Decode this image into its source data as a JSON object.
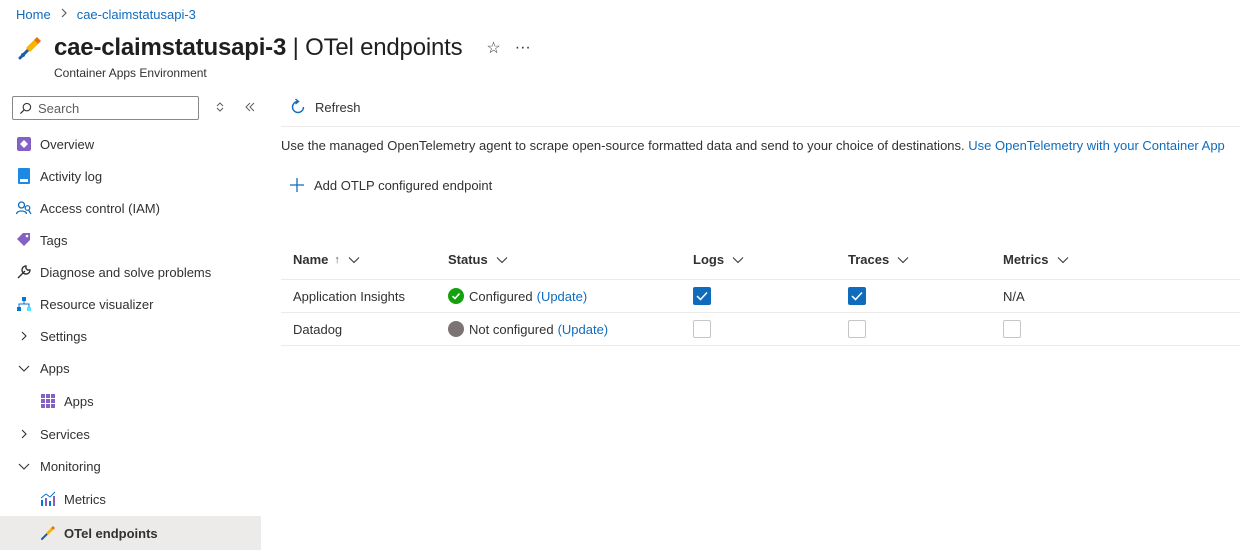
{
  "breadcrumb": {
    "home": "Home",
    "resource": "cae-claimstatusapi-3"
  },
  "header": {
    "title_resource": "cae-claimstatusapi-3",
    "title_page": "| OTel endpoints",
    "subtitle": "Container Apps Environment",
    "favorite_glyph": "☆",
    "more_glyph": "···"
  },
  "sidebar": {
    "search_placeholder": "Search",
    "items": [
      {
        "label": "Overview",
        "icon": "overview-icon"
      },
      {
        "label": "Activity log",
        "icon": "activity-log-icon"
      },
      {
        "label": "Access control (IAM)",
        "icon": "iam-icon"
      },
      {
        "label": "Tags",
        "icon": "tag-icon"
      },
      {
        "label": "Diagnose and solve problems",
        "icon": "wrench-icon"
      },
      {
        "label": "Resource visualizer",
        "icon": "resource-visualizer-icon"
      },
      {
        "label": "Settings",
        "icon": "chevron-right-icon"
      },
      {
        "label": "Apps",
        "icon": "chevron-down-icon"
      },
      {
        "label": "Apps",
        "icon": "apps-grid-icon"
      },
      {
        "label": "Services",
        "icon": "chevron-right-icon"
      },
      {
        "label": "Monitoring",
        "icon": "chevron-down-icon"
      },
      {
        "label": "Metrics",
        "icon": "metrics-icon"
      },
      {
        "label": "OTel endpoints",
        "icon": "otel-icon"
      }
    ]
  },
  "toolbar": {
    "refresh_label": "Refresh"
  },
  "content": {
    "description": "Use the managed OpenTelemetry agent to scrape open-source formatted data and send to your choice of destinations.",
    "description_link": "Use OpenTelemetry with your Container App",
    "add_label": "Add OTLP configured endpoint"
  },
  "table": {
    "columns": [
      "Name",
      "Status",
      "Logs",
      "Traces",
      "Metrics"
    ],
    "sort_glyph": "↑",
    "rows": [
      {
        "name": "Application Insights",
        "status": "Configured",
        "update": "(Update)",
        "logs": true,
        "traces": true,
        "metrics": "N/A"
      },
      {
        "name": "Datadog",
        "status": "Not configured",
        "update": "(Update)",
        "logs": false,
        "traces": false,
        "metrics": false
      }
    ]
  },
  "colors": {
    "accent": "#0f6cbd",
    "success": "#13a10e",
    "neutral": "#7a7574",
    "selected_bg": "#edebe9"
  }
}
